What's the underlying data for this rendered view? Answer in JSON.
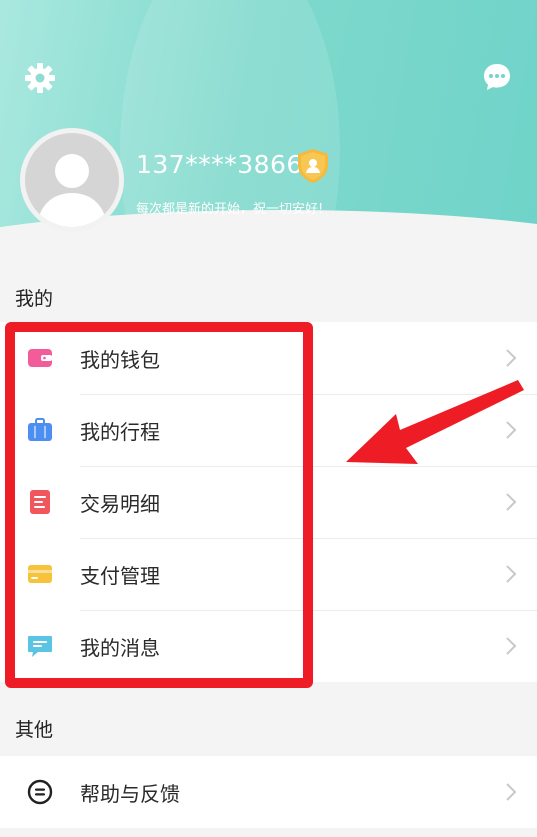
{
  "header": {
    "phone": "137****3866",
    "motto": "每次都是新的开始，祝一切安好!"
  },
  "sections": {
    "mine_title": "我的",
    "other_title": "其他"
  },
  "mine_items": [
    {
      "label": "我的钱包",
      "icon": "wallet-icon",
      "color": "#f25c9b"
    },
    {
      "label": "我的行程",
      "icon": "suitcase-icon",
      "color": "#4d8ff0"
    },
    {
      "label": "交易明细",
      "icon": "receipt-icon",
      "color": "#f0565b"
    },
    {
      "label": "支付管理",
      "icon": "card-icon",
      "color": "#f8c23a"
    },
    {
      "label": "我的消息",
      "icon": "message-icon",
      "color": "#5bc4e5"
    }
  ],
  "other_items": [
    {
      "label": "帮助与反馈",
      "icon": "help-feedback-icon",
      "color": "#222222"
    }
  ],
  "colors": {
    "header_start": "#a9e8df",
    "header_end": "#6fd3c9",
    "highlight": "#ee1c25"
  }
}
